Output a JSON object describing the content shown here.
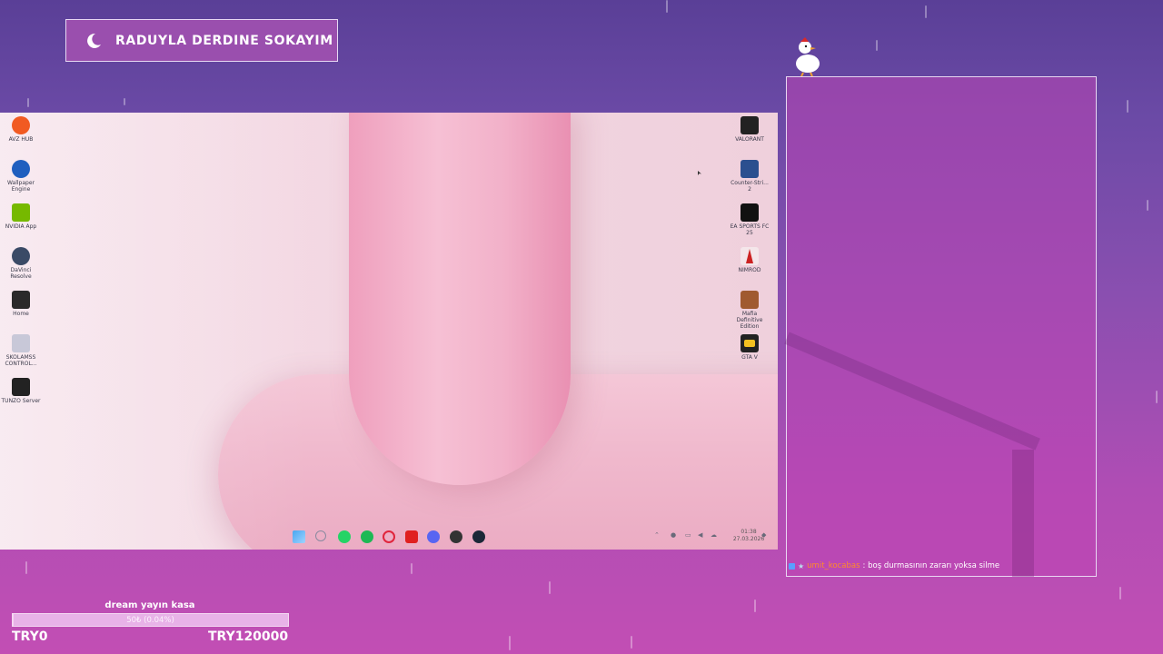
{
  "title_banner": {
    "text": "RADUYLA DERDINE SOKAYIM",
    "icon": "crescent-moon-icon"
  },
  "desktop": {
    "left_icons": [
      {
        "label": "AVZ HUB",
        "color": "#f15a22",
        "icon": "lightning-app-icon"
      },
      {
        "label": "Wallpaper Engine",
        "color": "#1f5fbf",
        "icon": "wallpaper-engine-icon"
      },
      {
        "label": "NVIDIA App",
        "color": "#76b900",
        "icon": "nvidia-icon"
      },
      {
        "label": "DaVinci Resolve",
        "color": "#3a4a66",
        "icon": "davinci-icon"
      },
      {
        "label": "Home",
        "color": "#2a2a2a",
        "icon": "home-app-icon"
      },
      {
        "label": "SKOLAMSS CONTROL...",
        "color": "#c8c8d8",
        "icon": "control-app-icon"
      },
      {
        "label": "TUNZO Server",
        "color": "#222222",
        "icon": "server-app-icon"
      }
    ],
    "right_icons": [
      {
        "label": "VALORANT",
        "color": "#222222",
        "icon": "valorant-icon"
      },
      {
        "label": "Counter-Stri... 2",
        "color": "#2b4f8f",
        "icon": "counter-strike-icon"
      },
      {
        "label": "EA SPORTS FC 25",
        "color": "#111111",
        "icon": "ea-sports-icon"
      },
      {
        "label": "NIMROD",
        "color": "#cc2222",
        "icon": "nimrod-icon"
      },
      {
        "label": "Mafia Definitive Edition",
        "color": "#a05a30",
        "icon": "mafia-icon"
      },
      {
        "label": "GTA V",
        "color": "#222222",
        "icon": "gta-icon"
      }
    ],
    "taskbar_apps": [
      {
        "name": "start",
        "color": "#48a7f0",
        "icon": "windows-start-icon"
      },
      {
        "name": "search",
        "color": "#8a8aa0",
        "icon": "search-icon"
      },
      {
        "name": "whatsapp",
        "color": "#25d366",
        "icon": "whatsapp-icon"
      },
      {
        "name": "spotify",
        "color": "#1db954",
        "icon": "spotify-icon"
      },
      {
        "name": "opera",
        "color": "#e0253c",
        "icon": "opera-icon"
      },
      {
        "name": "youtube",
        "color": "#e02020",
        "icon": "youtube-icon"
      },
      {
        "name": "discord",
        "color": "#5865f2",
        "icon": "discord-icon"
      },
      {
        "name": "obs",
        "color": "#333333",
        "icon": "obs-icon"
      },
      {
        "name": "steam",
        "color": "#1b2838",
        "icon": "steam-icon"
      }
    ],
    "clock": {
      "time": "01:38",
      "date": "27.03.2026"
    }
  },
  "chat": {
    "username": "umit_kocabas",
    "message": ": boş durmasının zararı yoksa silme"
  },
  "donation_goal": {
    "title": "dream yayın kasa",
    "progress_text": "50₺ (0.04%)",
    "progress_percent": 0.04,
    "min_label": "TRY0",
    "max_label": "TRY120000"
  }
}
